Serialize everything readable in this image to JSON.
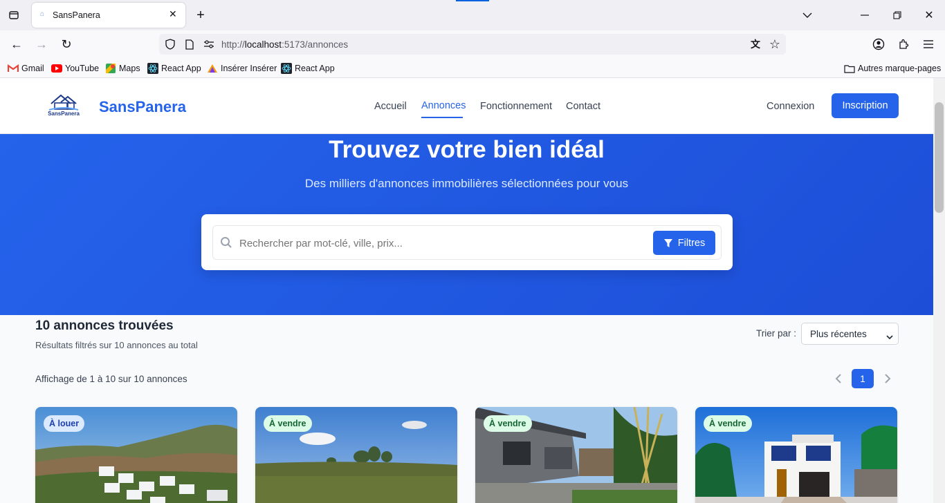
{
  "browser": {
    "tab_title": "SansPanera",
    "url_prefix": "http://",
    "url_host": "localhost",
    "url_rest": ":5173/annonces",
    "bookmarks": [
      {
        "label": "Gmail",
        "icon": "gmail-icon"
      },
      {
        "label": "YouTube",
        "icon": "youtube-icon"
      },
      {
        "label": "Maps",
        "icon": "maps-icon"
      },
      {
        "label": "React App",
        "icon": "react-icon"
      },
      {
        "label": "Insérer Insérer",
        "icon": "site-icon"
      },
      {
        "label": "React App",
        "icon": "react-icon"
      }
    ],
    "other_bookmarks": "Autres marque-pages"
  },
  "header": {
    "brand": "SansPanera",
    "logo_text": "SansPanera",
    "nav": [
      "Accueil",
      "Annonces",
      "Fonctionnement",
      "Contact"
    ],
    "active_nav": "Annonces",
    "login": "Connexion",
    "signup": "Inscription"
  },
  "hero": {
    "title": "Trouvez votre bien idéal",
    "subtitle": "Des milliers d'annonces immobilières sélectionnées pour vous",
    "search_placeholder": "Rechercher par mot-clé, ville, prix...",
    "filters_label": "Filtres"
  },
  "results": {
    "heading": "10 annonces trouvées",
    "subheading": "Résultats filtrés sur 10 annonces au total",
    "sort_label": "Trier par :",
    "sort_value": "Plus récentes",
    "showing": "Affichage de 1 à 10 sur 10 annonces",
    "current_page": "1"
  },
  "listings": [
    {
      "badge": "À louer",
      "badge_kind": "rent"
    },
    {
      "badge": "À vendre",
      "badge_kind": "sale"
    },
    {
      "badge": "À vendre",
      "badge_kind": "sale"
    },
    {
      "badge": "À vendre",
      "badge_kind": "sale"
    }
  ],
  "colors": {
    "primary": "#2563eb",
    "rent_badge_bg": "#dbeafe",
    "rent_badge_fg": "#1e40af",
    "sale_badge_bg": "#dcfce7",
    "sale_badge_fg": "#166534"
  }
}
